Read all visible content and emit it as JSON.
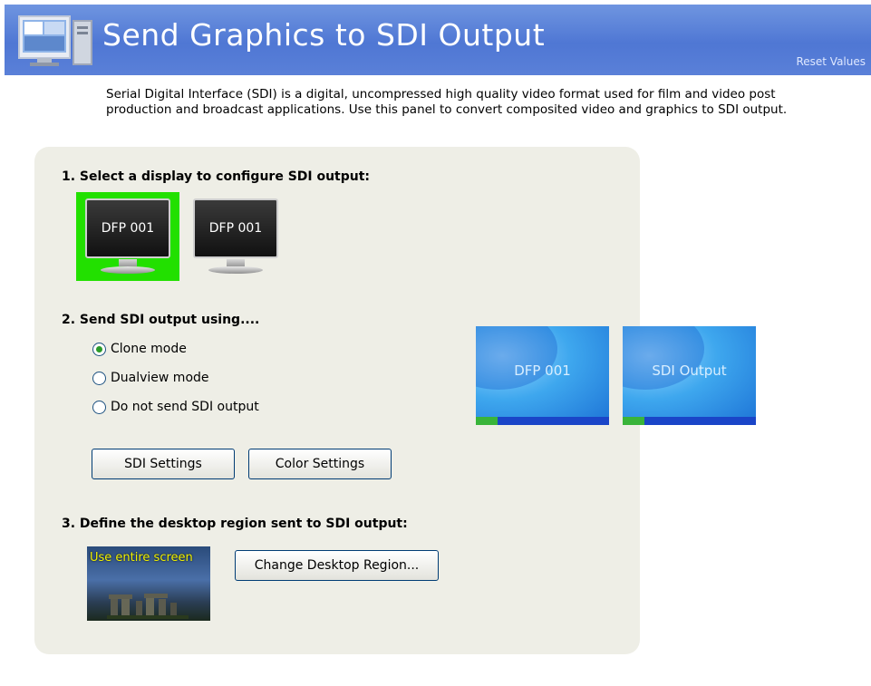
{
  "header": {
    "title": "Send Graphics to SDI Output",
    "reset_link": "Reset Values"
  },
  "description": "Serial Digital Interface (SDI) is a digital, uncompressed high quality video format used for film and video post production and broadcast applications. Use this panel to convert composited video and graphics to SDI output.",
  "section1": {
    "title": "1. Select a display to configure SDI output:",
    "displays": [
      {
        "label": "DFP 001",
        "selected": true
      },
      {
        "label": "DFP 001",
        "selected": false
      }
    ]
  },
  "section2": {
    "title": "2. Send SDI output using....",
    "options": [
      {
        "label": "Clone mode",
        "checked": true
      },
      {
        "label": "Dualview mode",
        "checked": false
      },
      {
        "label": "Do not send SDI output",
        "checked": false
      }
    ],
    "buttons": {
      "sdi_settings": "SDI Settings",
      "color_settings": "Color Settings"
    },
    "previews": [
      {
        "label": "DFP 001"
      },
      {
        "label": "SDI Output"
      }
    ]
  },
  "section3": {
    "title": "3. Define the desktop region sent to SDI output:",
    "thumbnail_text": "Use entire screen",
    "change_button": "Change Desktop Region..."
  },
  "colors": {
    "header": "#5a80d8",
    "panel": "#eeeee6",
    "selected_display": "#22e000"
  }
}
